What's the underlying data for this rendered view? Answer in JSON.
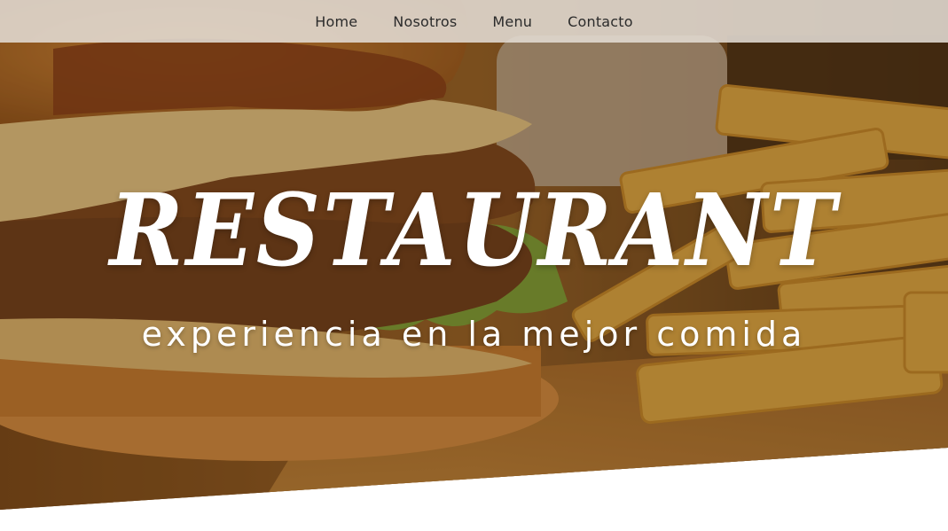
{
  "nav": {
    "items": [
      {
        "label": "Home"
      },
      {
        "label": "Nosotros"
      },
      {
        "label": "Menu"
      },
      {
        "label": "Contacto"
      }
    ]
  },
  "hero": {
    "title": "RESTAURANT",
    "subtitle": "experiencia en la mejor comida",
    "image_subject": "burger-and-fries-photo"
  },
  "colors": {
    "navbar_bg": "#e2dcd4",
    "nav_text": "#2b2b2b",
    "hero_text": "#ffffff",
    "overlay": "#8a5a1c",
    "page_bg": "#ffffff"
  }
}
